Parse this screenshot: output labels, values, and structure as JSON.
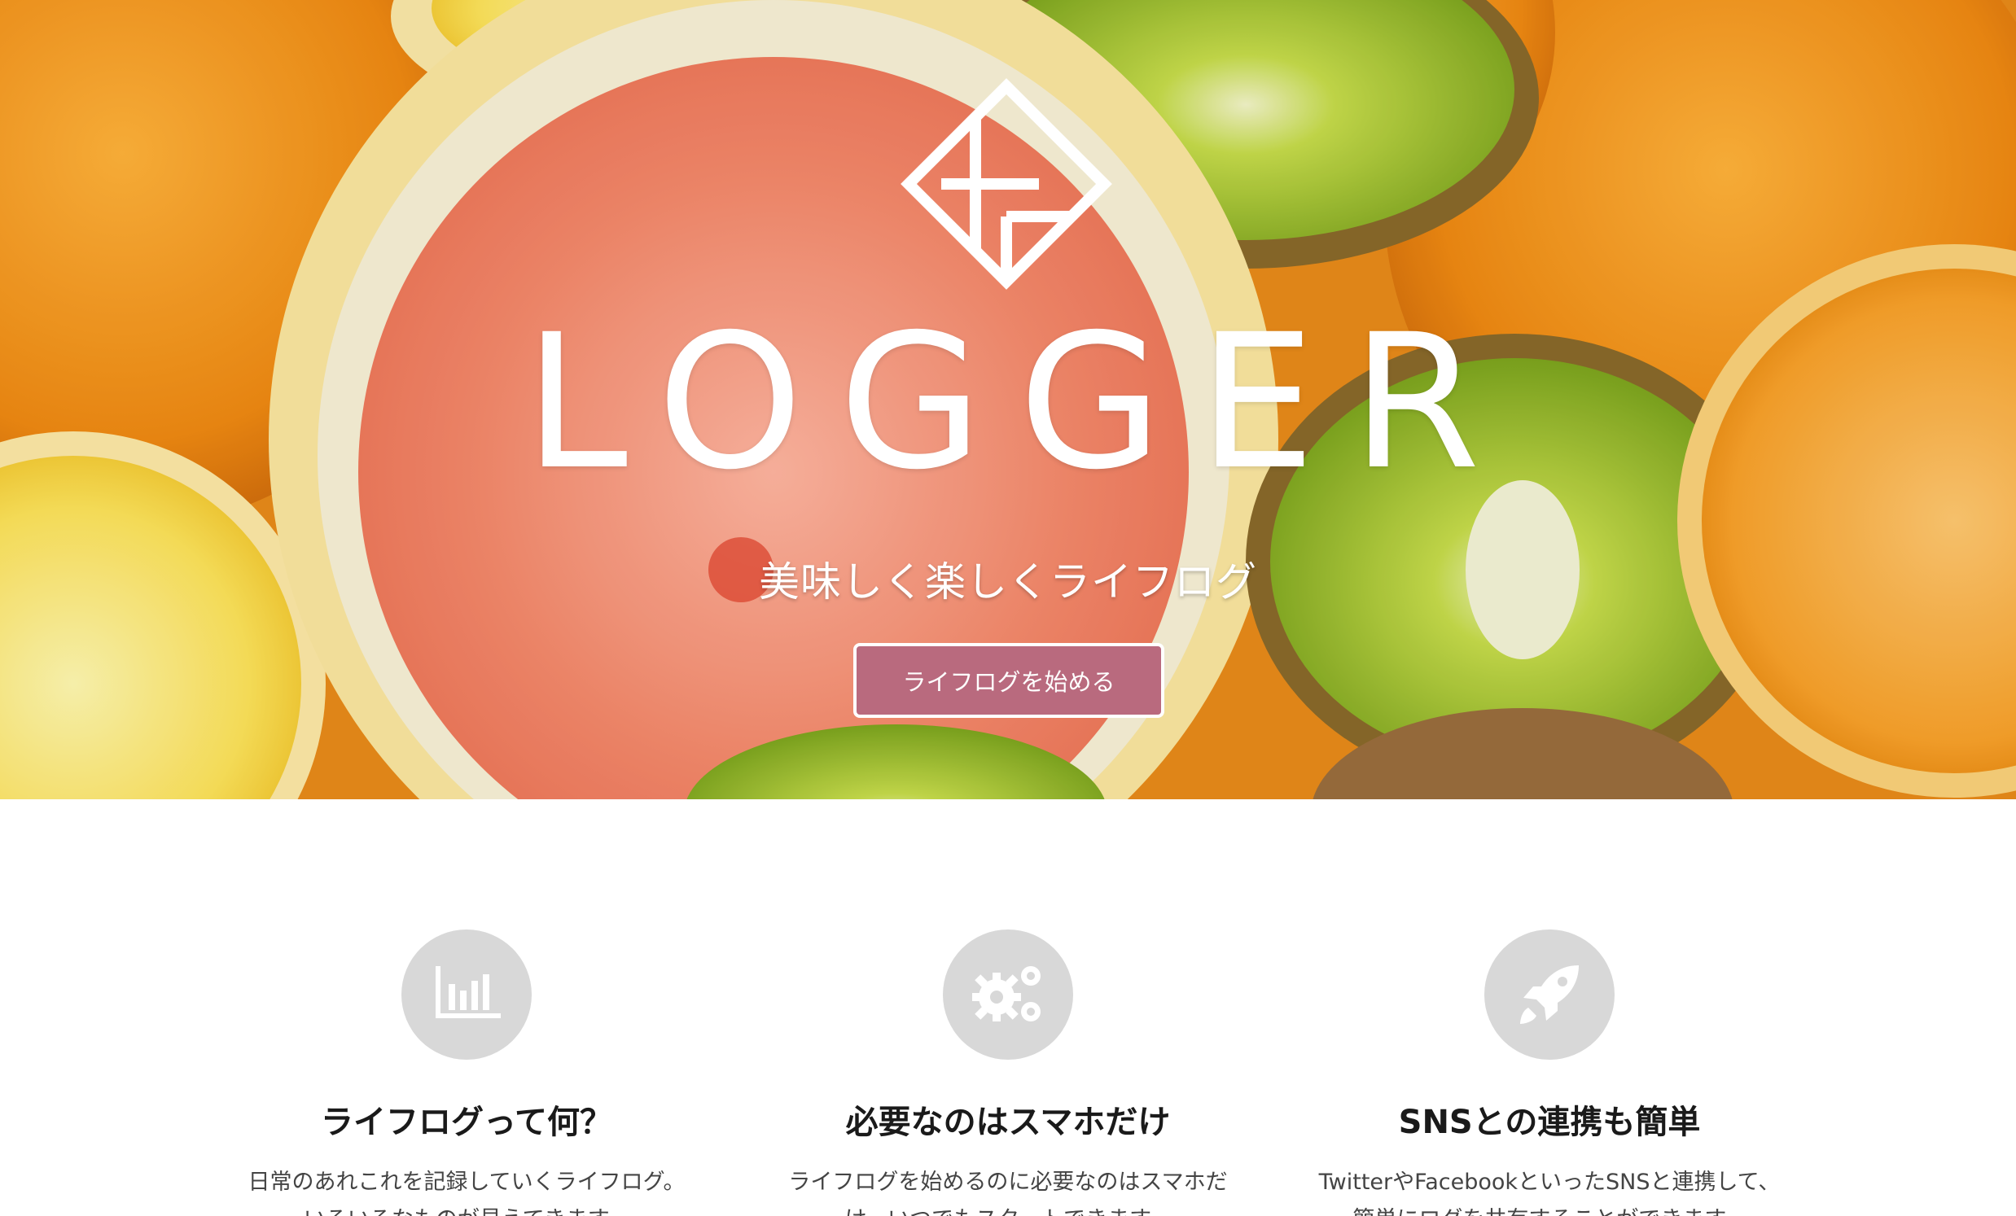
{
  "hero": {
    "brand": "LOGGER",
    "tagline": "美味しく楽しくライフログ",
    "cta_label": "ライフログを始める"
  },
  "features": [
    {
      "icon": "bar-chart-icon",
      "title": "ライフログって何？",
      "text_line1": "日常のあれこれを記録していくライフログ。",
      "text_line2": "いろいろなものが見えてきます。"
    },
    {
      "icon": "gears-icon",
      "title": "必要なのはスマホだけ",
      "text_line1": "ライフログを始めるのに必要なのはスマホだ",
      "text_line2": "け。いつでもスタートできます。"
    },
    {
      "icon": "rocket-icon",
      "title": "SNSとの連携も簡単",
      "text_line1": "TwitterやFacebookといったSNSと連携して、",
      "text_line2": "簡単にログを共有することができます。"
    }
  ],
  "colors": {
    "cta_background": "#b96a7e",
    "icon_circle": "#d8d8d8",
    "brand_text": "#ffffff"
  }
}
